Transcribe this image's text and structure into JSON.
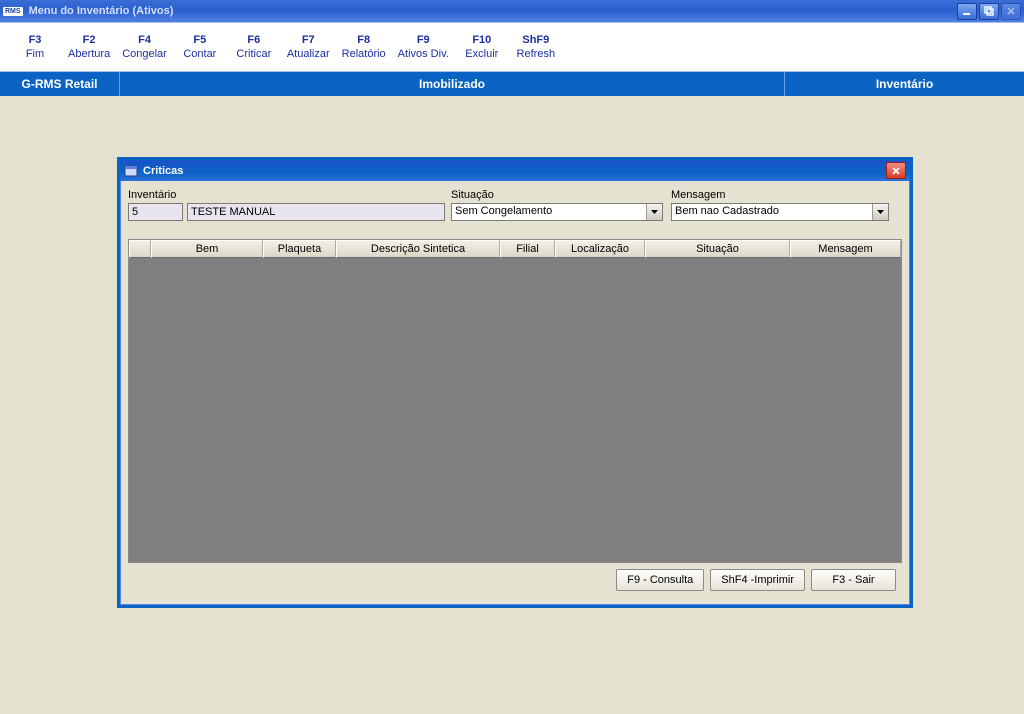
{
  "window": {
    "badge": "RMS",
    "title": "Menu do Inventário (Ativos)"
  },
  "fkeys": [
    {
      "shortcut": "F3",
      "label": "Fim"
    },
    {
      "shortcut": "F2",
      "label": "Abertura"
    },
    {
      "shortcut": "F4",
      "label": "Congelar"
    },
    {
      "shortcut": "F5",
      "label": "Contar"
    },
    {
      "shortcut": "F6",
      "label": "Criticar"
    },
    {
      "shortcut": "F7",
      "label": "Atualizar"
    },
    {
      "shortcut": "F8",
      "label": "Relatório"
    },
    {
      "shortcut": "F9",
      "label": "Ativos Div."
    },
    {
      "shortcut": "F10",
      "label": "Excluir"
    },
    {
      "shortcut": "ShF9",
      "label": "Refresh"
    }
  ],
  "banner": {
    "left": "G-RMS Retail",
    "middle": "Imobilizado",
    "right": "Inventário"
  },
  "dialog": {
    "title": "Criticas",
    "filters": {
      "inventario_label": "Inventário",
      "inventario_num": "5",
      "inventario_name": "TESTE MANUAL",
      "situacao_label": "Situação",
      "situacao_value": "Sem Congelamento",
      "mensagem_label": "Mensagem",
      "mensagem_value": "Bem nao Cadastrado"
    },
    "columns": {
      "bem": "Bem",
      "plaqueta": "Plaqueta",
      "descricao": "Descrição Sintetica",
      "filial": "Filial",
      "localizacao": "Localização",
      "situacao": "Situação",
      "mensagem": "Mensagem"
    },
    "buttons": {
      "consulta": "F9 - Consulta",
      "imprimir": "ShF4 -Imprimir",
      "sair": "F3 - Sair"
    }
  }
}
